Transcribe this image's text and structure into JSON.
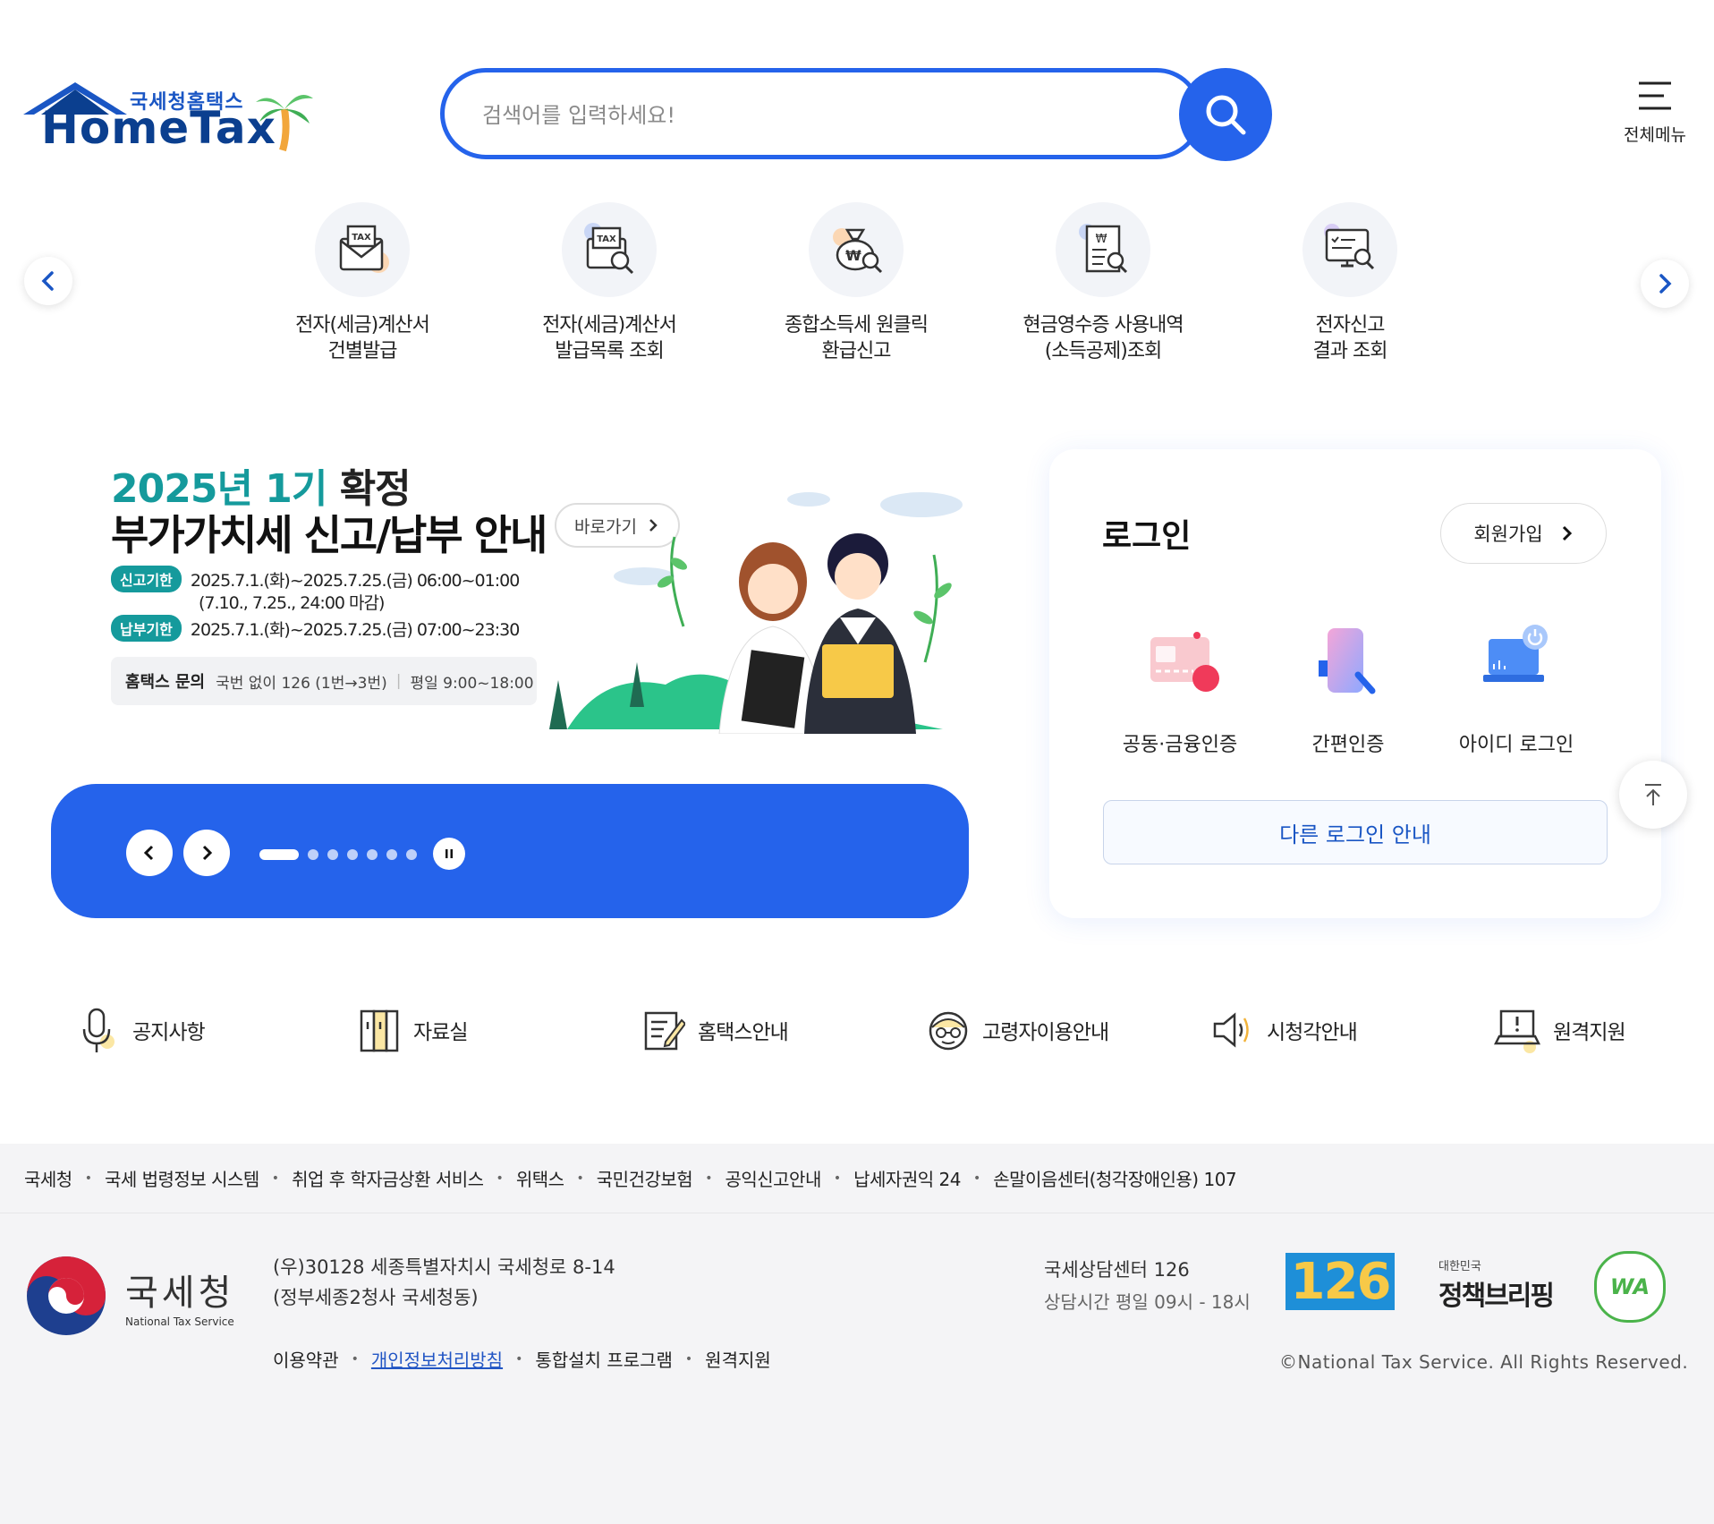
{
  "header": {
    "logo_sub": "국세청홈택스",
    "logo_main": "HomeTax",
    "search_placeholder": "검색어를 입력하세요!",
    "menu_label": "전체메뉴"
  },
  "quick_menu": [
    {
      "line1": "전자(세금)계산서",
      "line2": "건별발급",
      "icon": "tax-envelope-icon"
    },
    {
      "line1": "전자(세금)계산서",
      "line2": "발급목록 조회",
      "icon": "tax-search-icon"
    },
    {
      "line1": "종합소득세 원클릭",
      "line2": "환급신고",
      "icon": "money-bag-icon"
    },
    {
      "line1": "현금영수증 사용내역",
      "line2": "(소득공제)조회",
      "icon": "receipt-search-icon"
    },
    {
      "line1": "전자신고",
      "line2": "결과 조회",
      "icon": "monitor-search-icon"
    }
  ],
  "banner": {
    "title1_highlight": "2025년 1기",
    "title1_rest": "확정",
    "title2": "부가가치세 신고/납부 안내",
    "goto_label": "바로가기",
    "filing_tag": "신고기한",
    "filing_period": "2025.7.1.(화)~2025.7.25.(금) 06:00~01:00",
    "filing_note": "(7.10., 7.25., 24:00 마감)",
    "payment_tag": "납부기한",
    "payment_period": "2025.7.1.(화)~2025.7.25.(금) 07:00~23:30",
    "inquiry_label": "홈택스 문의",
    "inquiry_phone": "국번 없이 126 (1번→3번)",
    "inquiry_hours": "평일 9:00~18:00",
    "slide_count": 7,
    "active_slide": 1
  },
  "login": {
    "title": "로그인",
    "join_label": "회원가입",
    "options": [
      {
        "label": "공동·금융인증",
        "icon": "certificate-card-icon"
      },
      {
        "label": "간편인증",
        "icon": "phone-search-icon"
      },
      {
        "label": "아이디 로그인",
        "icon": "laptop-power-icon"
      }
    ],
    "other_login_label": "다른 로그인 안내"
  },
  "shortcuts": [
    {
      "label": "공지사항",
      "icon": "microphone-icon"
    },
    {
      "label": "자료실",
      "icon": "binder-icon"
    },
    {
      "label": "홈택스안내",
      "icon": "document-pen-icon"
    },
    {
      "label": "고령자이용안내",
      "icon": "elderly-face-icon"
    },
    {
      "label": "시청각안내",
      "icon": "speaker-icon"
    },
    {
      "label": "원격지원",
      "icon": "laptop-alert-icon"
    }
  ],
  "footer": {
    "links": [
      "국세청",
      "국세 법령정보 시스템",
      "취업 후 학자금상환 서비스",
      "위택스",
      "국민건강보험",
      "공익신고안내",
      "납세자권익 24",
      "손말이음센터(청각장애인용) 107"
    ],
    "org_name": "국세청",
    "org_name_en": "National Tax Service",
    "address_line1": "(우)30128 세종특별자치시 국세청로 8-14",
    "address_line2": "(정부세종2청사 국세청동)",
    "bottom_links": [
      "이용약관",
      "개인정보처리방침",
      "통합설치 프로그램",
      "원격지원"
    ],
    "center_name": "국세상담센터 126",
    "center_hours": "상담시간 평일 09시 - 18시",
    "badge_126": "126",
    "policy_brief_small": "대한민국",
    "policy_brief": "정책브리핑",
    "wa_mark": "WA",
    "copyright": "©National Tax Service. All Rights Reserved."
  },
  "colors": {
    "primary": "#2563eb",
    "teal": "#159a9c",
    "navy": "#0b3f8f"
  }
}
